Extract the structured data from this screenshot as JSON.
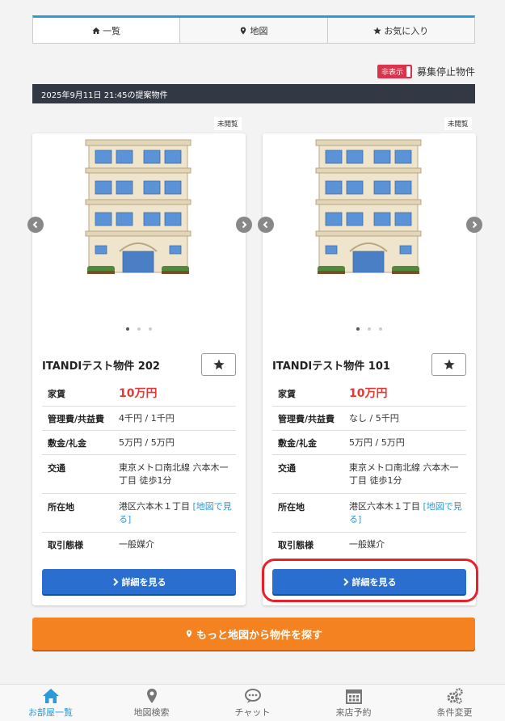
{
  "tabs": [
    {
      "label": "一覧",
      "icon": "home-icon",
      "active": true
    },
    {
      "label": "地図",
      "icon": "map-pin-icon",
      "active": false
    },
    {
      "label": "お気に入り",
      "icon": "star-icon",
      "active": false
    }
  ],
  "hidden_toggle": {
    "label": "非表示",
    "text": "募集停止物件"
  },
  "date_bar": "2025年9月11日 21:45の提案物件",
  "cards": [
    {
      "unread": "未閲覧",
      "title": "ITANDIテスト物件 202",
      "rows": [
        {
          "label": "家賃",
          "value": "10万円"
        },
        {
          "label": "管理費/共益費",
          "value": "4千円 / 1千円"
        },
        {
          "label": "敷金/礼金",
          "value": "5万円 / 5万円"
        },
        {
          "label": "交通",
          "value": "東京メトロ南北線 六本木一丁目 徒歩1分"
        },
        {
          "label": "所在地",
          "value": "港区六本木１丁目",
          "link": "[地図で見る]"
        },
        {
          "label": "取引態様",
          "value": "一般媒介"
        }
      ],
      "button": "詳細を見る"
    },
    {
      "unread": "未閲覧",
      "title": "ITANDIテスト物件 101",
      "rows": [
        {
          "label": "家賃",
          "value": "10万円"
        },
        {
          "label": "管理費/共益費",
          "value": "なし / 5千円"
        },
        {
          "label": "敷金/礼金",
          "value": "5万円 / 5万円"
        },
        {
          "label": "交通",
          "value": "東京メトロ南北線 六本木一丁目 徒歩1分"
        },
        {
          "label": "所在地",
          "value": "港区六本木１丁目",
          "link": "[地図で見る]"
        },
        {
          "label": "取引態様",
          "value": "一般媒介"
        }
      ],
      "button": "詳細を見る"
    }
  ],
  "map_button": "もっと地図から物件を探す",
  "bottom_nav": [
    {
      "label": "お部屋一覧",
      "icon": "home-icon",
      "active": true
    },
    {
      "label": "地図検索",
      "icon": "map-pin-icon",
      "active": false
    },
    {
      "label": "チャット",
      "icon": "chat-icon",
      "active": false
    },
    {
      "label": "来店予約",
      "icon": "calendar-icon",
      "active": false
    },
    {
      "label": "条件変更",
      "icon": "gears-icon",
      "active": false
    }
  ],
  "colors": {
    "accent": "#2a9ad8",
    "rent": "#e53935",
    "detail_button": "#2a6fcf",
    "map_button": "#f58220",
    "highlight": "#e8202a"
  }
}
